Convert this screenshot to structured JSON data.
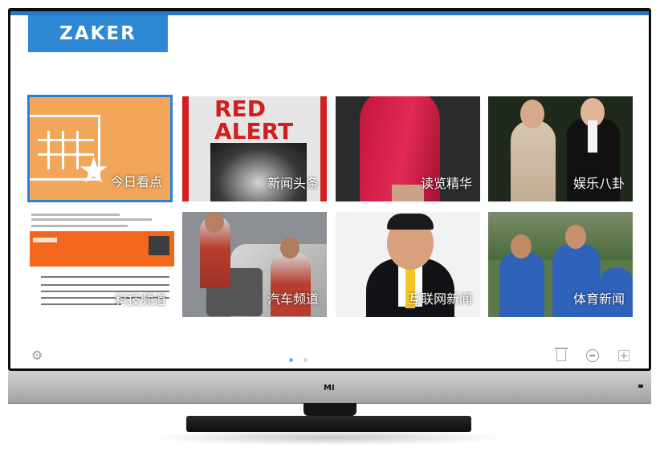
{
  "app": {
    "logo": "ZAKER"
  },
  "tv": {
    "brand": "MI"
  },
  "tiles": [
    {
      "label": "今日看点",
      "icon": "calendar-star-icon"
    },
    {
      "label": "新闻头条",
      "headline": "RED\nALERT"
    },
    {
      "label": "读览精华"
    },
    {
      "label": "娱乐八卦"
    },
    {
      "label": "科技频道"
    },
    {
      "label": "汽车频道"
    },
    {
      "label": "互联网新闻"
    },
    {
      "label": "体育新闻"
    }
  ],
  "pagination": {
    "current": 1,
    "total": 2
  },
  "colors": {
    "accent": "#2878c8",
    "tile1": "#f2a65a",
    "dot_active": "#67aef0"
  },
  "icons": {
    "settings": "gear-icon",
    "delete": "trash-icon",
    "remove": "minus-circle-icon",
    "add": "plus-square-icon"
  }
}
